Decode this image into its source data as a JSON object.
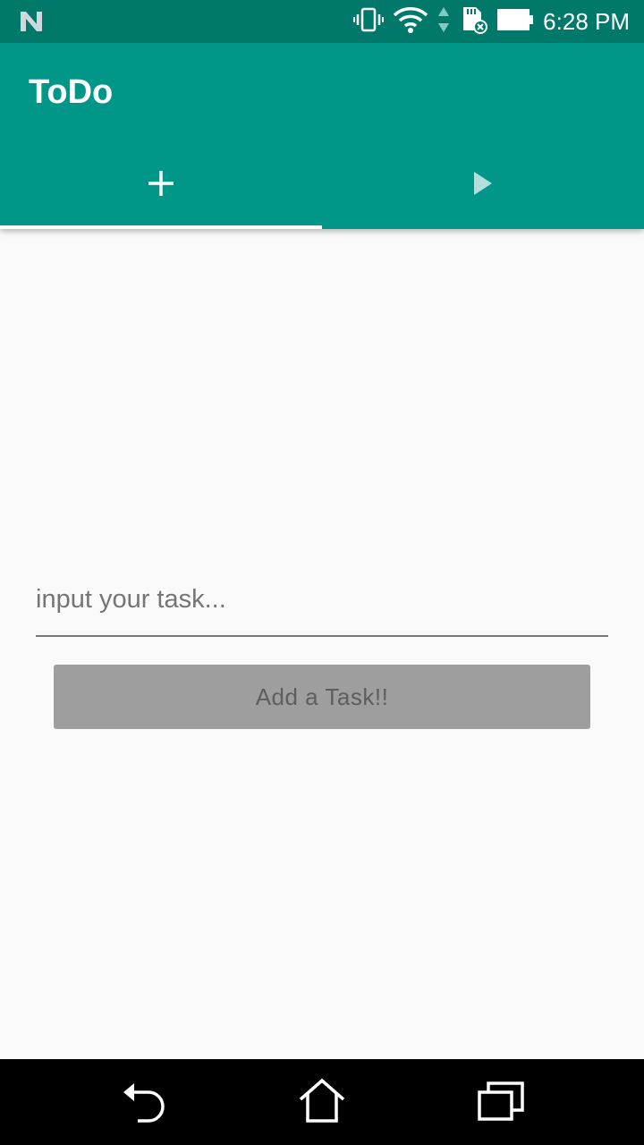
{
  "status_bar": {
    "time": "6:28 PM",
    "icons": [
      "notification-n-icon",
      "vibrate-icon",
      "wifi-icon",
      "data-arrows-icon",
      "sd-card-icon",
      "battery-icon"
    ],
    "color": "#00796b"
  },
  "app_bar": {
    "title": "ToDo",
    "color": "#009688",
    "tabs": [
      {
        "icon": "plus-icon",
        "selected": true
      },
      {
        "icon": "play-icon",
        "selected": false
      }
    ]
  },
  "main": {
    "task_input": {
      "placeholder": "input your task...",
      "value": ""
    },
    "add_button_label": "Add a Task!!"
  },
  "nav_bar": {
    "icons": [
      "back-icon",
      "home-icon",
      "recents-icon"
    ]
  }
}
